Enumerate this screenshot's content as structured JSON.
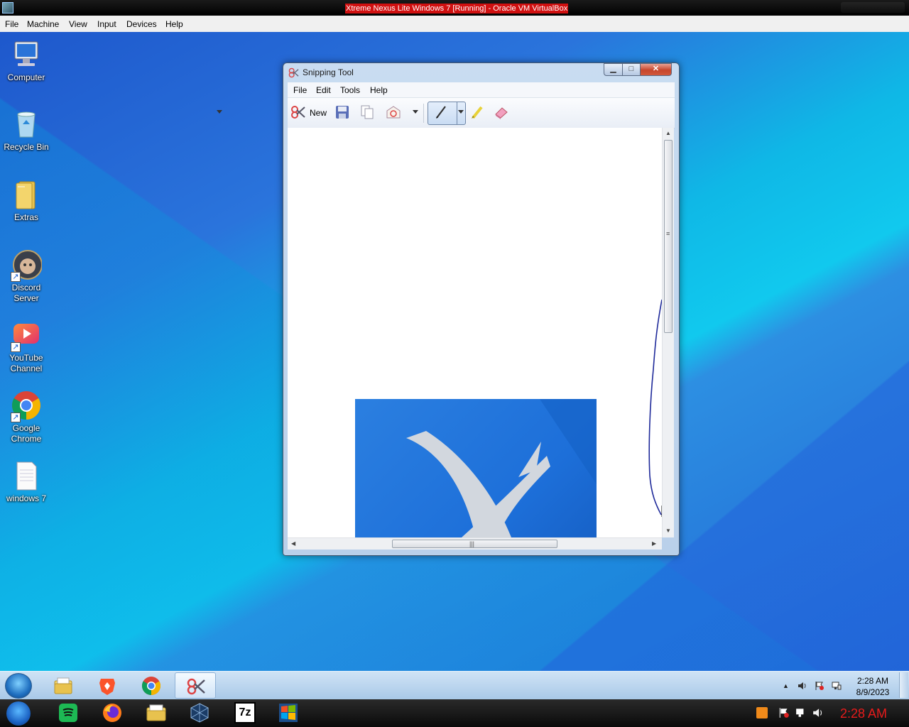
{
  "host": {
    "window_title": "Xtreme Nexus Lite Windows 7 [Running] - Oracle VM VirtualBox",
    "menu": [
      "File",
      "Machine",
      "View",
      "Input",
      "Devices",
      "Help"
    ],
    "clock": "2:28 AM"
  },
  "desktop": {
    "icons": [
      {
        "label_line1": "Computer",
        "label_line2": "",
        "icon": "computer-icon"
      },
      {
        "label_line1": "Recycle Bin",
        "label_line2": "",
        "icon": "recycle-bin-icon"
      },
      {
        "label_line1": "Extras",
        "label_line2": "",
        "icon": "folder-icon"
      },
      {
        "label_line1": "Discord",
        "label_line2": "Server",
        "icon": "discord-icon"
      },
      {
        "label_line1": "YouTube",
        "label_line2": "Channel",
        "icon": "youtube-icon"
      },
      {
        "label_line1": "Google",
        "label_line2": "Chrome",
        "icon": "chrome-icon"
      },
      {
        "label_line1": "windows 7",
        "label_line2": "",
        "icon": "text-file-icon"
      }
    ]
  },
  "snipping_tool": {
    "title": "Snipping Tool",
    "menu": [
      "File",
      "Edit",
      "Tools",
      "Help"
    ],
    "toolbar": {
      "new_label": "New",
      "tools": [
        "new-snip-icon",
        "save-icon",
        "copy-icon",
        "send-snip-icon",
        "pen-icon",
        "highlighter-icon",
        "eraser-icon"
      ]
    },
    "window_buttons": {
      "minimize": "▁",
      "maximize": "□",
      "close": "✕"
    }
  },
  "taskbar": {
    "apps": [
      "explorer-icon",
      "brave-icon",
      "chrome-icon",
      "snipping-tool-icon"
    ],
    "time": "2:28 AM",
    "date": "8/9/2023"
  },
  "host_taskbar": {
    "apps": [
      "spotify-icon",
      "firefox-icon",
      "file-explorer-icon",
      "virtualbox-icon",
      "7zip-icon",
      "win7-vm-icon"
    ],
    "sevenzip_label": "7z"
  },
  "colors": {
    "title_highlight": "#d01010",
    "host_clock": "#e81b1b",
    "pen_stroke": "#1f2a9a"
  }
}
